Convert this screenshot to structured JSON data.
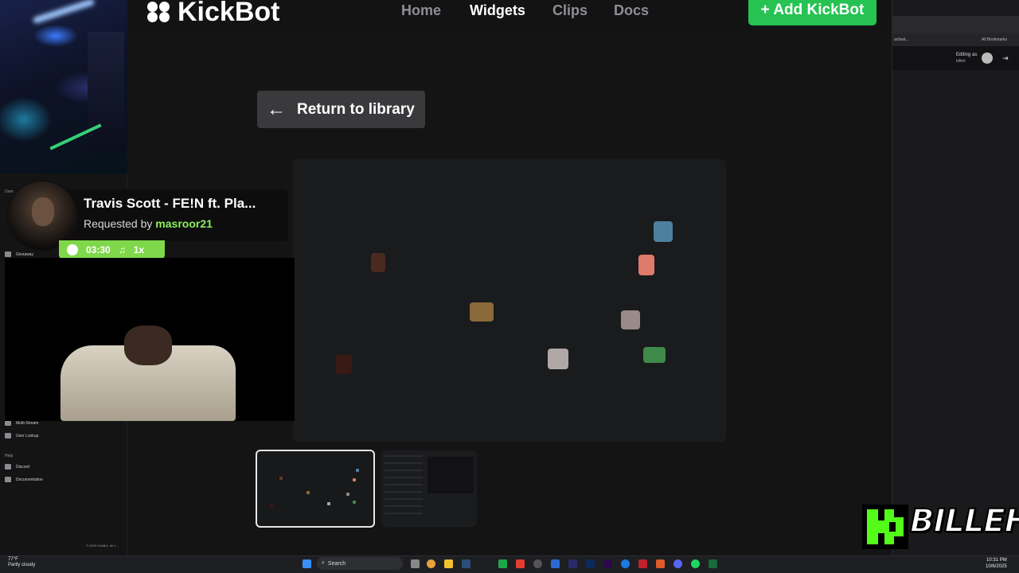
{
  "nav": {
    "brand": "KickBot",
    "links": [
      "Home",
      "Widgets",
      "Clips",
      "Docs"
    ],
    "active": "Widgets",
    "add_button": "+ Add KickBot"
  },
  "page": {
    "return_label": "Return to library"
  },
  "sidebar": {
    "section_user": "User ...",
    "item_giveaway": "Giveaway",
    "item_multistream": "Multi-Stream",
    "item_userlookup": "User Lookup",
    "section_help": "Help",
    "item_discord": "Discord",
    "item_docs": "Documentation",
    "footer": "© 2025 KickBot. All ri..."
  },
  "now_playing": {
    "title": "Travis Scott - FE!N ft. Pla...",
    "requested_prefix": "Requested by ",
    "requester": "masroor21",
    "duration": "03:30",
    "count": "1x"
  },
  "browser": {
    "tab_text": "activat...",
    "bookmarks": "All Bookmarks",
    "editing_as": "Editing as",
    "editing_user": "billeh"
  },
  "overlay": {
    "streamer_tag": "BILLEH"
  },
  "taskbar": {
    "temp": "77°F",
    "weather": "Partly cloudy",
    "search": "Search",
    "time": "10:31 PM",
    "date": "10/6/2025"
  },
  "colors": {
    "accent_green": "#26c252",
    "kick_green": "#53fc18",
    "badge_green": "#7fd84a"
  }
}
